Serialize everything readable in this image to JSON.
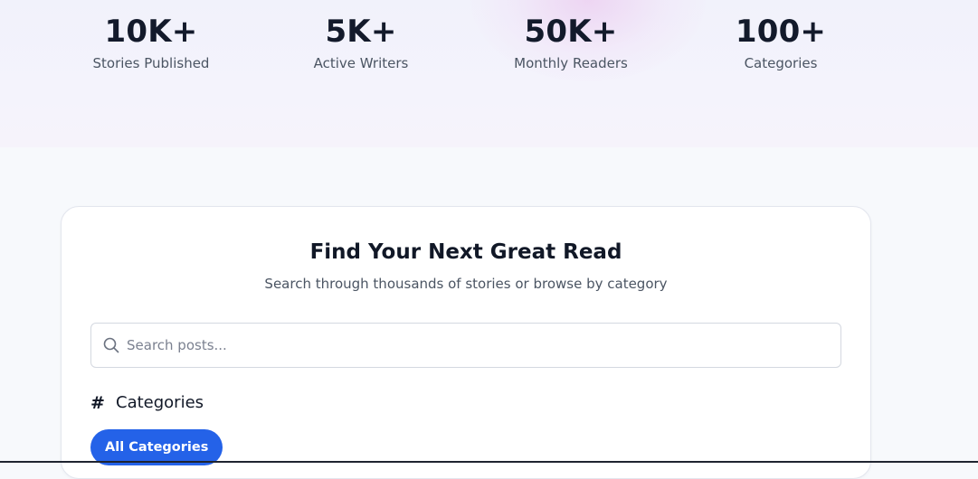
{
  "stats": [
    {
      "value": "10K+",
      "label": "Stories Published"
    },
    {
      "value": "5K+",
      "label": "Active Writers"
    },
    {
      "value": "50K+",
      "label": "Monthly Readers"
    },
    {
      "value": "100+",
      "label": "Categories"
    }
  ],
  "search_section": {
    "title": "Find Your Next Great Read",
    "subtitle": "Search through thousands of stories or browse by category",
    "search_placeholder": "Search posts...",
    "search_value": "",
    "search_icon": "search-icon"
  },
  "categories": {
    "heading": "Categories",
    "heading_icon": "hash-icon",
    "selected_chip": "All Categories"
  },
  "colors": {
    "accent": "#2462e8",
    "text_primary": "#111827",
    "text_secondary": "#4b5563"
  }
}
